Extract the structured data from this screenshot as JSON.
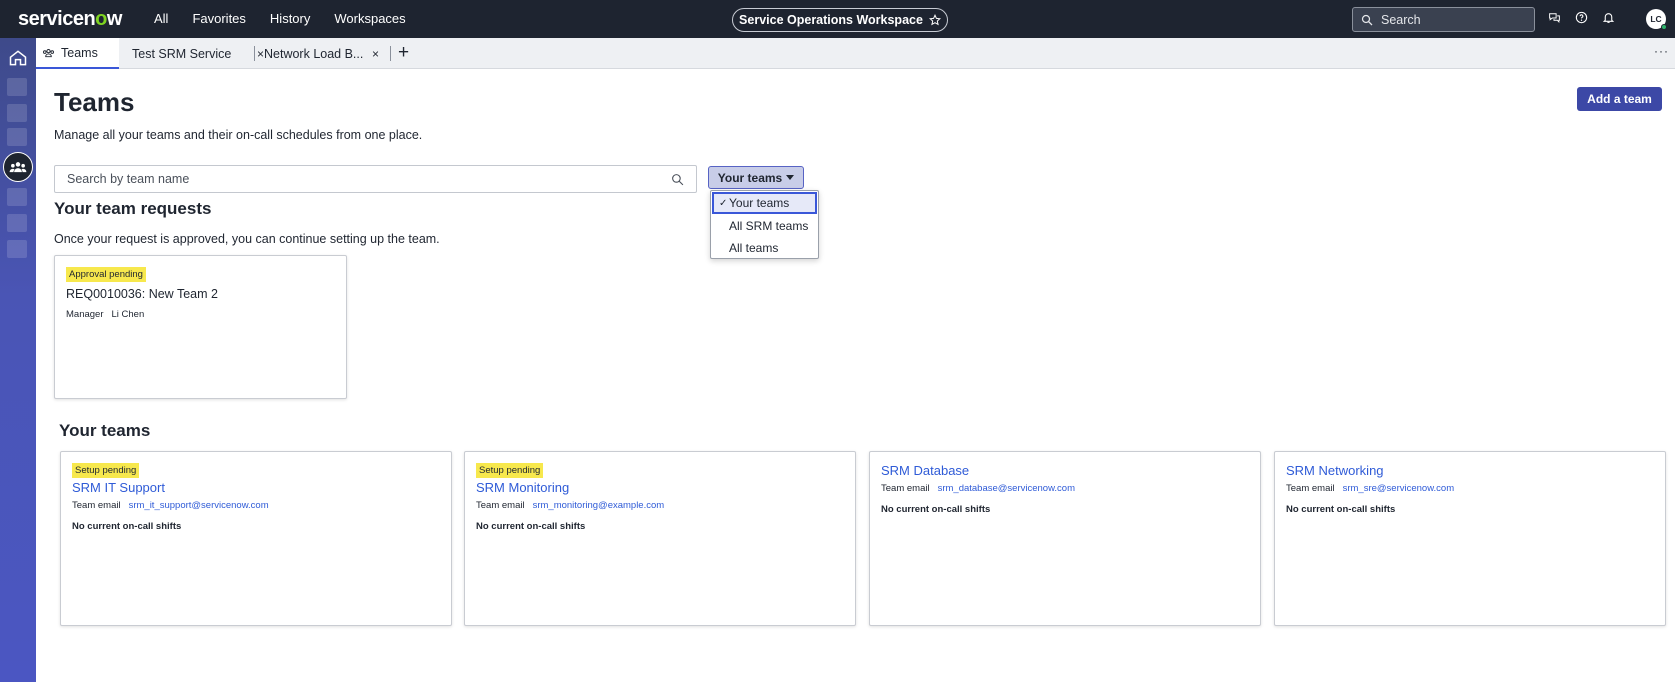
{
  "topbar": {
    "logo": "servicenow",
    "nav": [
      "All",
      "Favorites",
      "History",
      "Workspaces"
    ],
    "workspace": "Service Operations Workspace",
    "search_label": "Search",
    "avatar_initials": "LC"
  },
  "tabs": {
    "items": [
      {
        "label": "Teams"
      },
      {
        "label": "Test SRM Service"
      },
      {
        "label": "Network Load B..."
      }
    ],
    "close_glyph": "×",
    "add_glyph": "+",
    "more_glyph": "···"
  },
  "page": {
    "title": "Teams",
    "subtitle": "Manage all your teams and their on-call schedules from one place.",
    "add_button": "Add a team",
    "search_placeholder": "Search by team name",
    "filter": {
      "selected": "Your teams",
      "options": [
        "Your teams",
        "All SRM teams",
        "All teams"
      ]
    }
  },
  "requests": {
    "heading": "Your team requests",
    "subtitle": "Once your request is approved, you can continue setting up the team.",
    "cards": [
      {
        "badge": "Approval pending",
        "title": "REQ0010036: New Team 2",
        "manager_label": "Manager",
        "manager": "Li Chen"
      }
    ]
  },
  "your_teams": {
    "heading": "Your teams",
    "email_label": "Team email",
    "cards": [
      {
        "badge": "Setup pending",
        "name": "SRM IT Support",
        "email": "srm_it_support@servicenow.com",
        "shifts": "No current on-call shifts"
      },
      {
        "badge": "Setup pending",
        "name": "SRM Monitoring",
        "email": "srm_monitoring@example.com",
        "shifts": "No current on-call shifts"
      },
      {
        "badge": "",
        "name": "SRM Database",
        "email": "srm_database@servicenow.com",
        "shifts": "No current on-call shifts"
      },
      {
        "badge": "",
        "name": "SRM Networking",
        "email": "srm_sre@servicenow.com",
        "shifts": "No current on-call shifts"
      }
    ]
  },
  "colors": {
    "topbar": "#1e2430",
    "rail": "#4b56c2",
    "primary_button": "#3c48a6",
    "link": "#2f5bd7",
    "badge": "#f7e84d"
  }
}
